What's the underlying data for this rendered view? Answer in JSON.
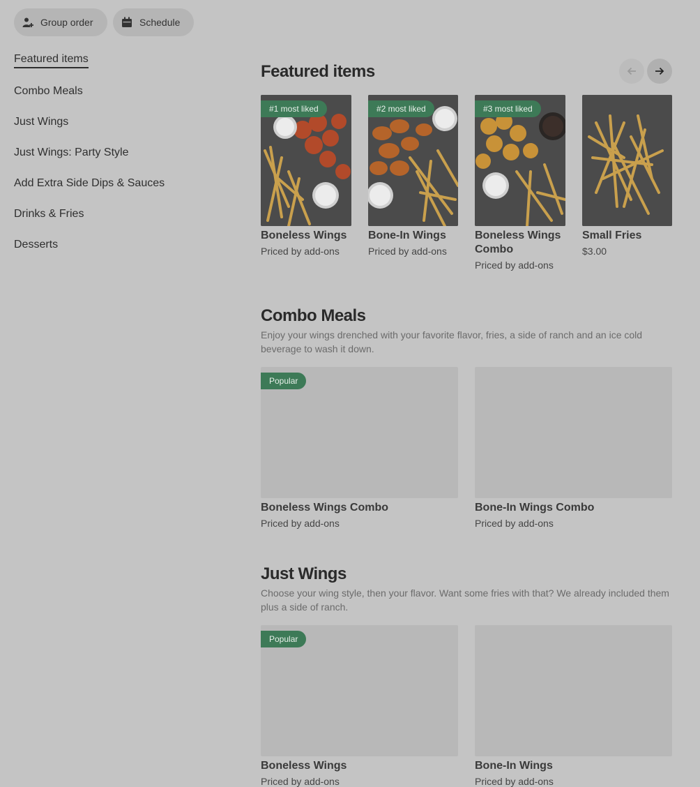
{
  "top_actions": {
    "group_order": "Group order",
    "schedule": "Schedule"
  },
  "nav": {
    "items": [
      "Featured items",
      "Combo Meals",
      "Just Wings",
      "Just Wings: Party Style",
      "Add Extra Side Dips & Sauces",
      "Drinks & Fries",
      "Desserts"
    ],
    "active": "Featured items"
  },
  "featured": {
    "title": "Featured items",
    "items": [
      {
        "badge": "#1 most liked",
        "name": "Boneless Wings",
        "price": "Priced by add-ons"
      },
      {
        "badge": "#2 most liked",
        "name": "Bone-In Wings",
        "price": "Priced by add-ons"
      },
      {
        "badge": "#3 most liked",
        "name": "Boneless Wings Combo",
        "price": "Priced by add-ons"
      },
      {
        "badge": "",
        "name": "Small Fries",
        "price": "$3.00"
      }
    ]
  },
  "combo": {
    "title": "Combo Meals",
    "desc": "Enjoy your wings drenched with your favorite flavor, fries, a side of ranch and an ice cold beverage to wash it down.",
    "items": [
      {
        "badge": "Popular",
        "name": "Boneless Wings Combo",
        "price": "Priced by add-ons"
      },
      {
        "badge": "",
        "name": "Bone-In Wings Combo",
        "price": "Priced by add-ons"
      }
    ]
  },
  "just_wings": {
    "title": "Just Wings",
    "desc": "Choose your wing style, then your flavor. Want some fries with that? We already included them plus a side of ranch.",
    "items": [
      {
        "badge": "Popular",
        "name": "Boneless Wings",
        "price": "Priced by add-ons"
      },
      {
        "badge": "",
        "name": "Bone-In Wings",
        "price": "Priced by add-ons"
      }
    ]
  },
  "colors": {
    "badge_green": "#3d7a57",
    "overlay_bg": "#c4c4c4"
  }
}
